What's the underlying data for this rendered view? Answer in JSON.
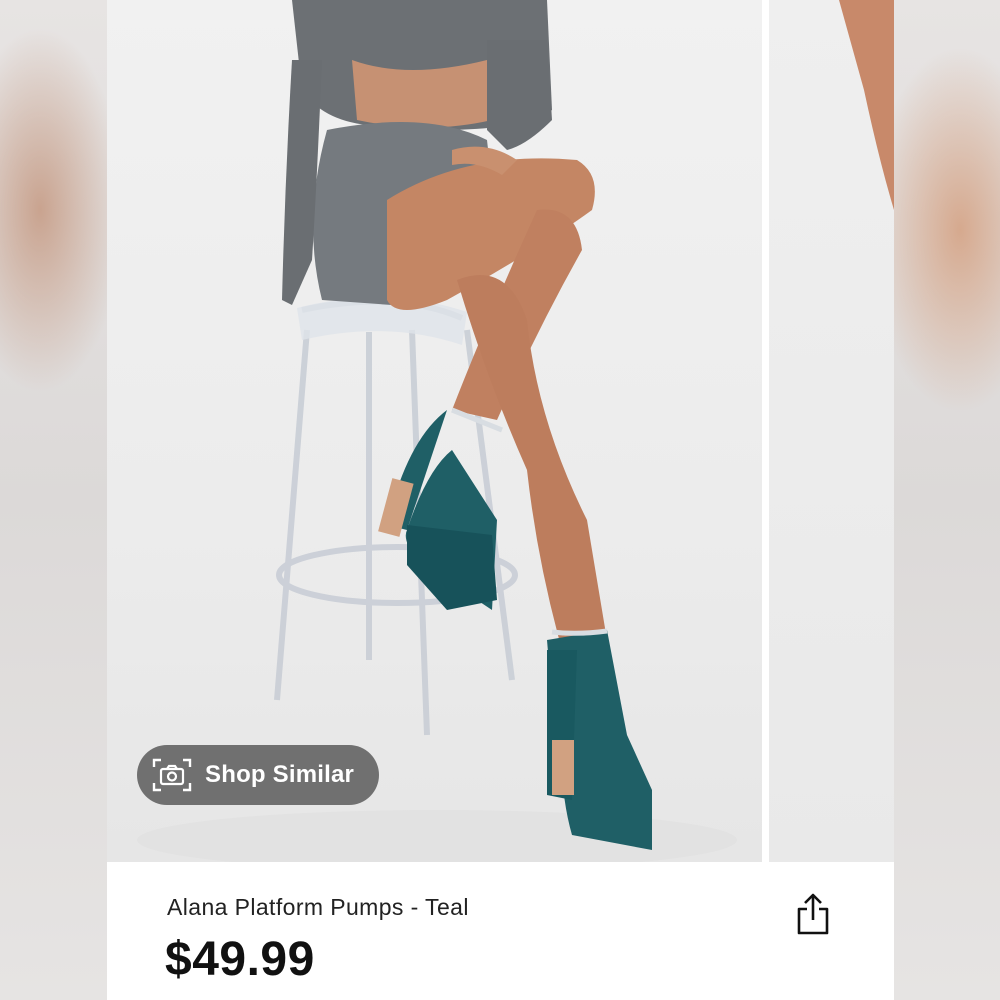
{
  "product": {
    "title": "Alana Platform Pumps - Teal",
    "price": "$49.99"
  },
  "actions": {
    "shop_similar_label": "Shop Similar"
  },
  "icons": {
    "camera": "camera-icon",
    "share": "share-icon"
  },
  "colors": {
    "teal_shoe": "#1f5f66",
    "pill_background": "#5a5a5a",
    "text": "#111111"
  }
}
